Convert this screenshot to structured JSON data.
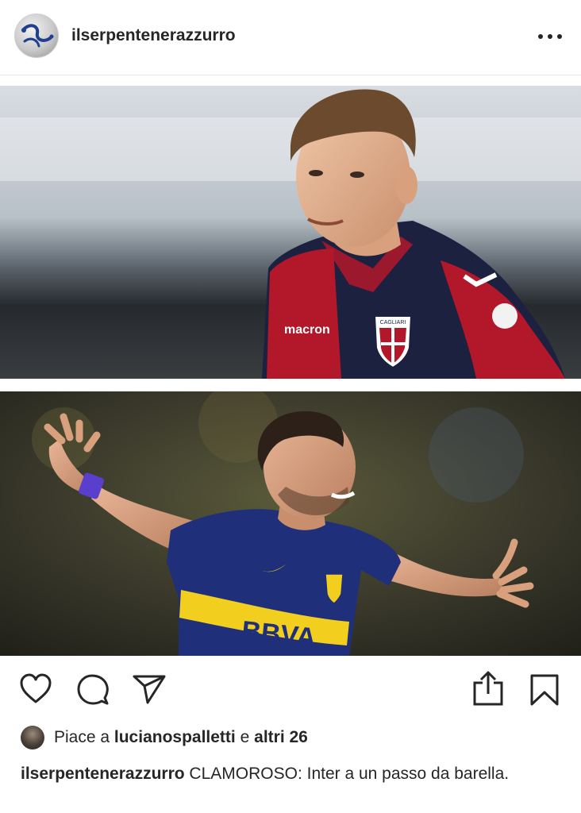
{
  "post": {
    "username": "ilserpentenerazzurro",
    "more_icon": "more-horizontal-icon"
  },
  "photos": {
    "top": {
      "sponsor_text": "macron",
      "crest_text": "CAGLIARI"
    },
    "bottom": {
      "sponsor_text": "BBVA"
    }
  },
  "actions": {
    "like_icon": "heart-icon",
    "comment_icon": "comment-icon",
    "share_icon": "send-icon",
    "upload_icon": "share-upload-icon",
    "save_icon": "bookmark-icon"
  },
  "likes": {
    "prefix": "Piace a",
    "user": "lucianospalletti",
    "joiner": "e",
    "others": "altri 26"
  },
  "caption": {
    "username": "ilserpentenerazzurro",
    "text": "CLAMOROSO: Inter a un passo da barella."
  },
  "colors": {
    "text": "#262626",
    "cagliari_red": "#b3172a",
    "cagliari_navy": "#1c2140",
    "boca_blue": "#1f2f7a",
    "boca_yellow": "#f2cf1f"
  }
}
